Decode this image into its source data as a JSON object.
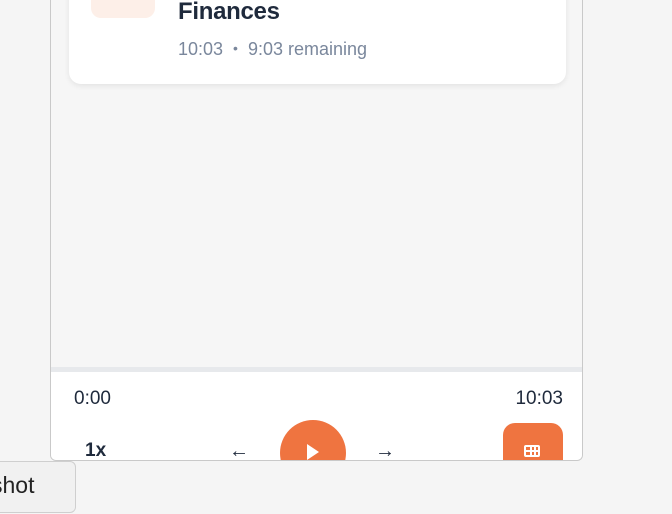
{
  "episode_card": {
    "title": "Finances",
    "duration": "10:03",
    "separator": "•",
    "remaining": "9:03 remaining"
  },
  "player": {
    "current_time": "0:00",
    "total_time": "10:03",
    "speed_label": "1x",
    "back_icon": "arrow-left-icon",
    "forward_icon": "arrow-right-icon",
    "play_icon": "play-icon",
    "grid_icon": "grid-icon",
    "accent_color": "#ef7440"
  },
  "tooltip": {
    "label": "shot"
  }
}
